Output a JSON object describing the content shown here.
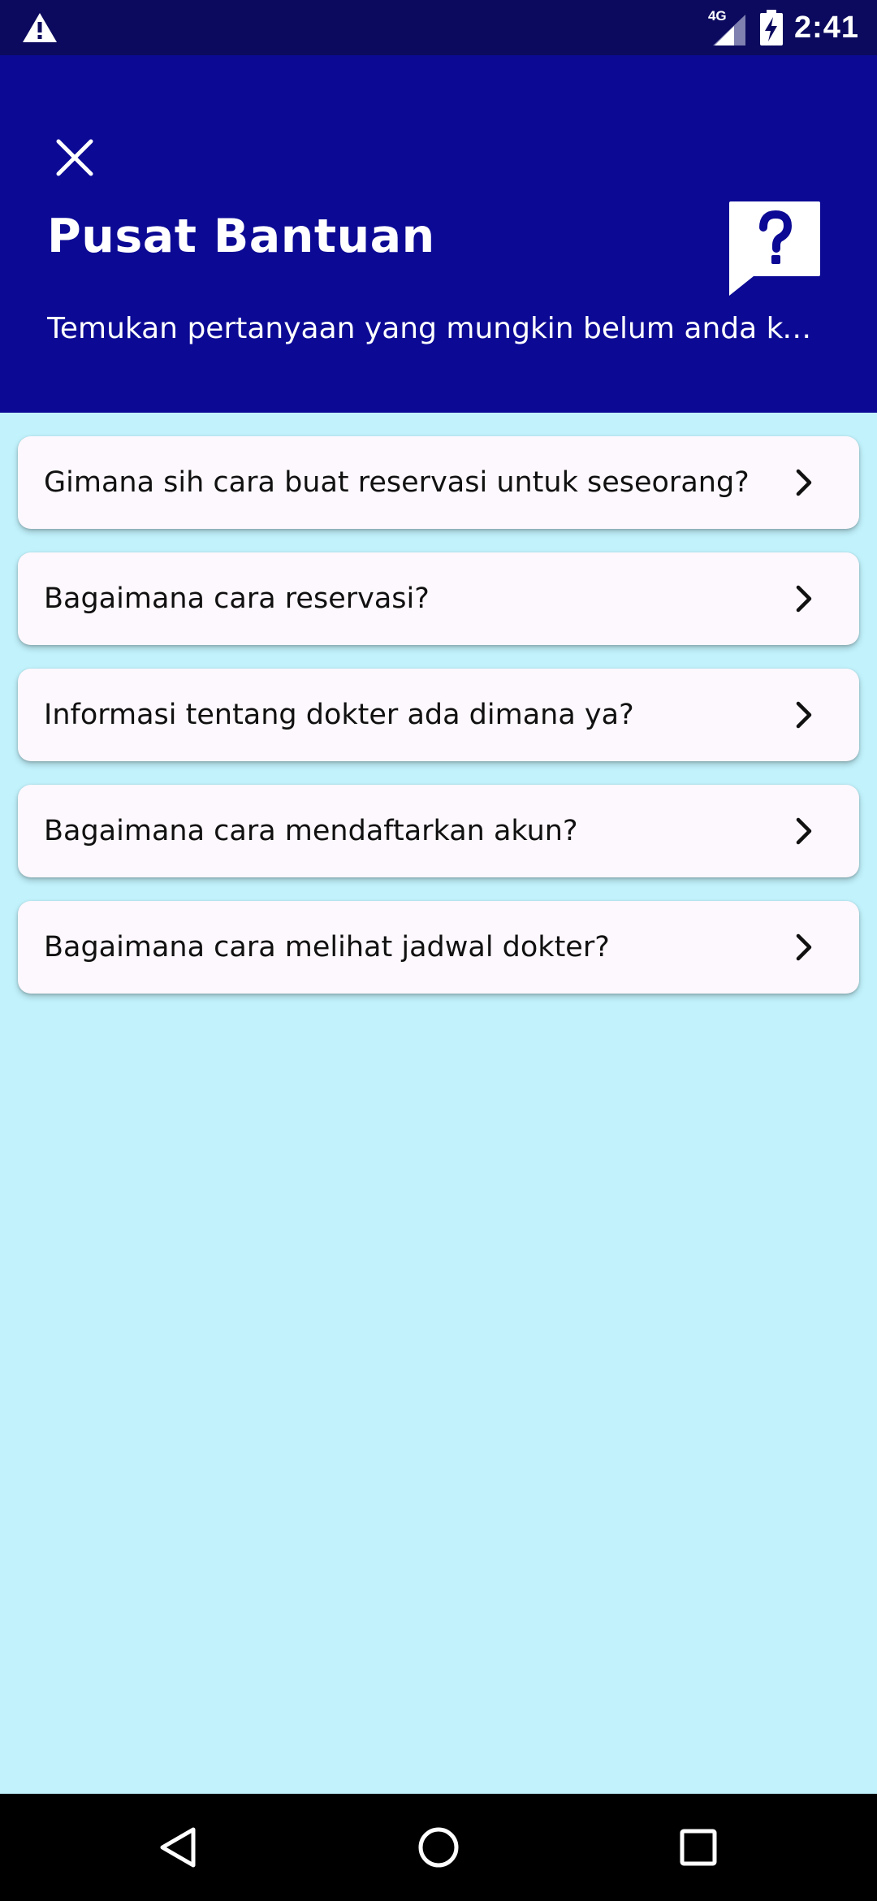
{
  "status_bar": {
    "network": "4G",
    "time": "2:41",
    "warning_icon": "warning-icon",
    "signal_icon": "signal-icon",
    "battery_icon": "battery-charging-icon"
  },
  "header": {
    "title": "Pusat Bantuan",
    "subtitle": "Temukan pertanyaan yang mungkin belum anda ketahui",
    "close_icon": "close-icon",
    "illustration_icon": "help-question-bubble-icon",
    "background_color": "#0c0a94"
  },
  "faq": {
    "items": [
      {
        "label": "Gimana sih cara buat reservasi untuk seseorang?"
      },
      {
        "label": "Bagaimana cara reservasi?"
      },
      {
        "label": "Informasi tentang dokter ada dimana ya?"
      },
      {
        "label": "Bagaimana cara mendaftarkan akun?"
      },
      {
        "label": "Bagaimana cara melihat jadwal dokter?"
      }
    ],
    "chevron_icon": "chevron-right-icon"
  },
  "navigation": {
    "back_icon": "back-triangle-icon",
    "home_icon": "home-circle-icon",
    "recents_icon": "recents-square-icon"
  },
  "colors": {
    "status_bar": "#0b0a5e",
    "header": "#0c0a94",
    "page_background": "#c2f3fd",
    "card_background": "#fdf8fd"
  }
}
